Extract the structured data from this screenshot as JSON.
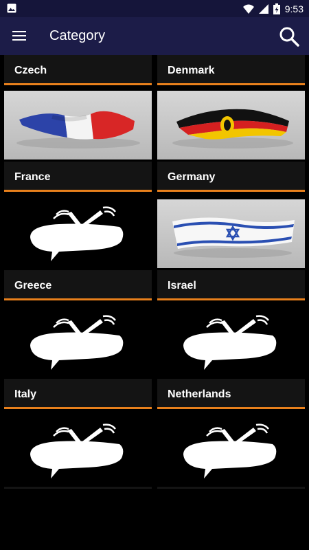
{
  "status_bar": {
    "time": "9:53",
    "icons": [
      "image-icon",
      "wifi-icon",
      "signal-icon",
      "battery-charging-icon"
    ]
  },
  "toolbar": {
    "title": "Category",
    "menu_icon": "hamburger-menu-icon",
    "search_icon": "search-icon"
  },
  "categories": [
    {
      "name": "Czech",
      "image": "none"
    },
    {
      "name": "Denmark",
      "image": "none"
    },
    {
      "name": "France",
      "image": "flag-france"
    },
    {
      "name": "Germany",
      "image": "flag-germany"
    },
    {
      "name": "Greece",
      "image": "tv-placeholder"
    },
    {
      "name": "Israel",
      "image": "flag-israel"
    },
    {
      "name": "Italy",
      "image": "tv-placeholder"
    },
    {
      "name": "Netherlands",
      "image": "tv-placeholder"
    },
    {
      "name": "",
      "image": "tv-placeholder"
    },
    {
      "name": "",
      "image": "tv-placeholder"
    }
  ],
  "colors": {
    "status_bar": "#15153a",
    "toolbar": "#1c1c48",
    "card_label_bg": "#141414",
    "accent_underline": "#e8801c",
    "background": "#000000"
  }
}
